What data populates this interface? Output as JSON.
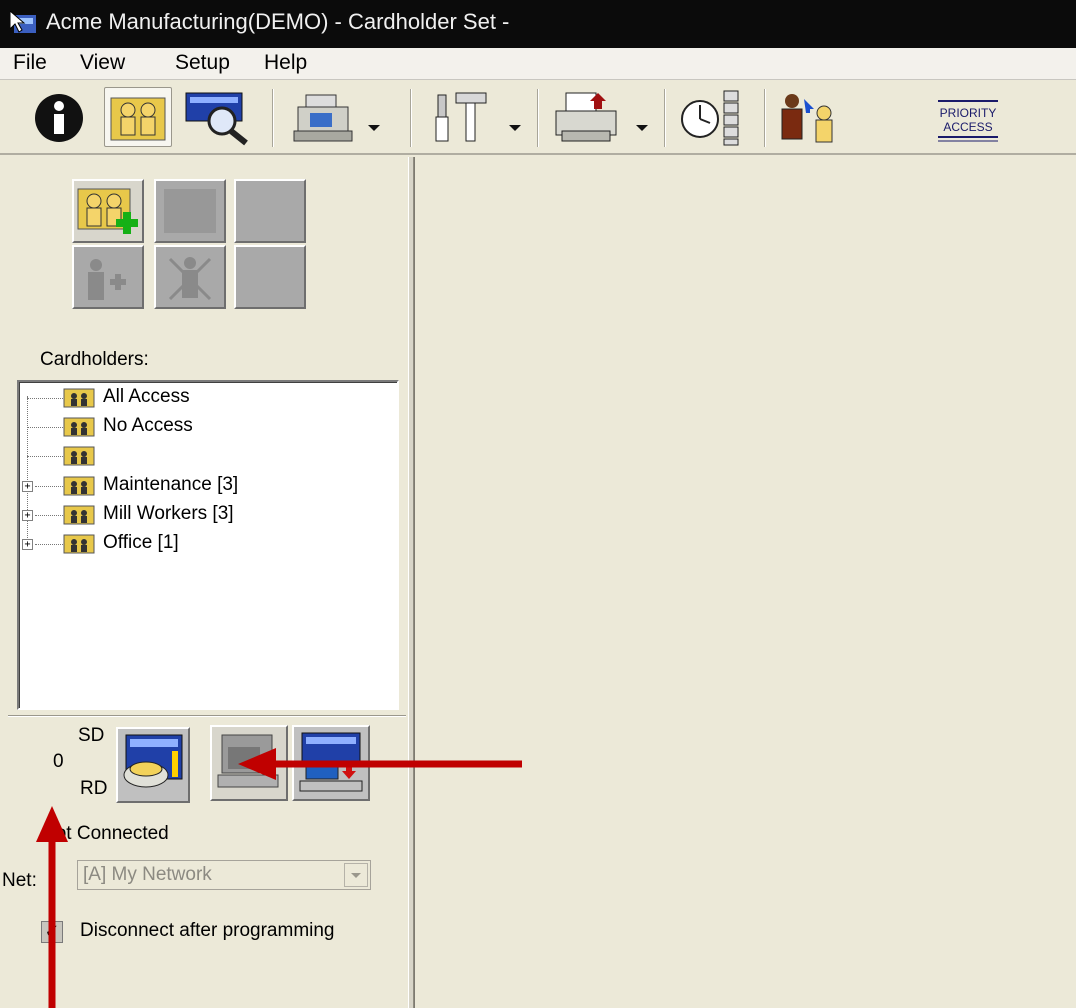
{
  "window": {
    "title": "Acme Manufacturing(DEMO) - Cardholder Set -"
  },
  "menu": [
    "File",
    "View",
    "Setup",
    "Help"
  ],
  "toolbar": {
    "priority_access_line1": "PRIORITY",
    "priority_access_line2": "ACCESS"
  },
  "left_panel": {
    "cardholders_label": "Cardholders:",
    "tree": [
      {
        "label": "All Access",
        "expandable": false
      },
      {
        "label": "No Access",
        "expandable": false
      },
      {
        "label": "",
        "expandable": false
      },
      {
        "label": "Maintenance [3]",
        "expandable": true
      },
      {
        "label": "Mill Workers [3]",
        "expandable": true
      },
      {
        "label": "Office [1]",
        "expandable": true
      }
    ],
    "comm": {
      "sd_label": "SD",
      "count": "0",
      "rd_label": "RD",
      "status": "Not Connected",
      "net_label": "Net:",
      "network_value": "[A] My Network",
      "disconnect_label": "Disconnect after programming",
      "disconnect_checked": true
    }
  },
  "colors": {
    "annotation_arrow": "#c00000",
    "folder": "#e8c84a"
  }
}
